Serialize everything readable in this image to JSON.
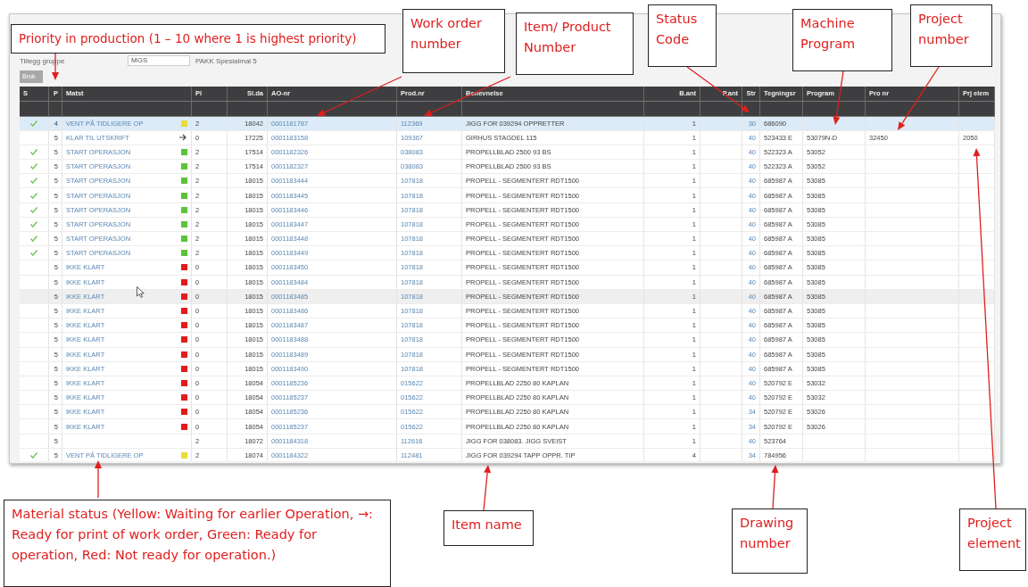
{
  "filter": {
    "label": "Tillegg gruppe",
    "value": "MGS",
    "note": "PAKK Spesialmal 5",
    "apply_button": "Bruk"
  },
  "table": {
    "columns": [
      "S",
      "P",
      "Matst",
      "Pl",
      "Sl.da",
      "AO-nr",
      "Prod.nr",
      "Benevnelse",
      "B.ant",
      "P.ant",
      "Str",
      "Tegningsr",
      "Program",
      "Pro nr",
      "Prj elem"
    ],
    "rows": [
      {
        "done": true,
        "selected": true,
        "hovered": false,
        "p": "4",
        "matst": "VENT PÅ TIDLIGERE OP",
        "material": {
          "kind": "square",
          "color": "#e8dc3a"
        },
        "pl": "2",
        "slda": "18042",
        "ao": "0001181787",
        "prod": "112369",
        "name": "JIGG FOR 039294 OPPRETTER",
        "bant": "1",
        "str": "30",
        "drawing": "686090"
      },
      {
        "done": false,
        "selected": false,
        "hovered": false,
        "p": "5",
        "matst": "KLAR TIL UTSKRIFT",
        "material": {
          "kind": "arrow"
        },
        "pl": "0",
        "slda": "17225",
        "ao": "0001183158",
        "prod": "109367",
        "name": "GIRHUS STAGDEL 115",
        "bant": "1",
        "str": "40",
        "drawing": "523433 E",
        "program": "53079N-D",
        "project": "32450",
        "element": "2050"
      },
      {
        "done": true,
        "selected": false,
        "hovered": false,
        "p": "5",
        "matst": "START OPERASJON",
        "material": {
          "kind": "square",
          "color": "#5cc23a"
        },
        "pl": "2",
        "slda": "17514",
        "ao": "0001182326",
        "prod": "038083",
        "name": "PROPELLBLAD 2500 93 BS",
        "bant": "1",
        "str": "40",
        "drawing": "522323 A",
        "program": "53052"
      },
      {
        "done": true,
        "selected": false,
        "hovered": false,
        "p": "5",
        "matst": "START OPERASJON",
        "material": {
          "kind": "square",
          "color": "#5cc23a"
        },
        "pl": "2",
        "slda": "17514",
        "ao": "0001182327",
        "prod": "038083",
        "name": "PROPELLBLAD 2500 93 BS",
        "bant": "1",
        "str": "40",
        "drawing": "522323 A",
        "program": "53052"
      },
      {
        "done": true,
        "selected": false,
        "hovered": false,
        "p": "5",
        "matst": "START OPERASJON",
        "material": {
          "kind": "square",
          "color": "#5cc23a"
        },
        "pl": "2",
        "slda": "18015",
        "ao": "0001183444",
        "prod": "107818",
        "name": "PROPELL  - SEGMENTERT RDT1500",
        "bant": "1",
        "str": "40",
        "drawing": "685987 A",
        "program": "53085"
      },
      {
        "done": true,
        "selected": false,
        "hovered": false,
        "p": "5",
        "matst": "START OPERASJON",
        "material": {
          "kind": "square",
          "color": "#5cc23a"
        },
        "pl": "2",
        "slda": "18015",
        "ao": "0001183445",
        "prod": "107818",
        "name": "PROPELL  - SEGMENTERT RDT1500",
        "bant": "1",
        "str": "40",
        "drawing": "685987 A",
        "program": "53085"
      },
      {
        "done": true,
        "selected": false,
        "hovered": false,
        "p": "5",
        "matst": "START OPERASJON",
        "material": {
          "kind": "square",
          "color": "#5cc23a"
        },
        "pl": "2",
        "slda": "18015",
        "ao": "0001183446",
        "prod": "107818",
        "name": "PROPELL  - SEGMENTERT RDT1500",
        "bant": "1",
        "str": "40",
        "drawing": "685987 A",
        "program": "53085"
      },
      {
        "done": true,
        "selected": false,
        "hovered": false,
        "p": "5",
        "matst": "START OPERASJON",
        "material": {
          "kind": "square",
          "color": "#5cc23a"
        },
        "pl": "2",
        "slda": "18015",
        "ao": "0001183447",
        "prod": "107818",
        "name": "PROPELL  - SEGMENTERT RDT1500",
        "bant": "1",
        "str": "40",
        "drawing": "685987 A",
        "program": "53085"
      },
      {
        "done": true,
        "selected": false,
        "hovered": false,
        "p": "5",
        "matst": "START OPERASJON",
        "material": {
          "kind": "square",
          "color": "#5cc23a"
        },
        "pl": "2",
        "slda": "18015",
        "ao": "0001183448",
        "prod": "107818",
        "name": "PROPELL  - SEGMENTERT RDT1500",
        "bant": "1",
        "str": "40",
        "drawing": "685987 A",
        "program": "53085"
      },
      {
        "done": true,
        "selected": false,
        "hovered": false,
        "p": "5",
        "matst": "START OPERASJON",
        "material": {
          "kind": "square",
          "color": "#5cc23a"
        },
        "pl": "2",
        "slda": "18015",
        "ao": "0001183449",
        "prod": "107818",
        "name": "PROPELL  - SEGMENTERT RDT1500",
        "bant": "1",
        "str": "40",
        "drawing": "685987 A",
        "program": "53085"
      },
      {
        "done": false,
        "selected": false,
        "hovered": false,
        "p": "5",
        "matst": "IKKE KLART",
        "material": {
          "kind": "square",
          "color": "#e21b1b"
        },
        "pl": "0",
        "slda": "18015",
        "ao": "0001183450",
        "prod": "107818",
        "name": "PROPELL  - SEGMENTERT RDT1500",
        "bant": "1",
        "str": "40",
        "drawing": "685987 A",
        "program": "53085"
      },
      {
        "done": false,
        "selected": false,
        "hovered": false,
        "p": "5",
        "matst": "IKKE KLART",
        "material": {
          "kind": "square",
          "color": "#e21b1b"
        },
        "pl": "0",
        "slda": "18015",
        "ao": "0001183484",
        "prod": "107818",
        "name": "PROPELL  - SEGMENTERT RDT1500",
        "bant": "1",
        "str": "40",
        "drawing": "685987 A",
        "program": "53085"
      },
      {
        "done": false,
        "selected": false,
        "hovered": true,
        "p": "5",
        "matst": "IKKE KLART",
        "material": {
          "kind": "square",
          "color": "#e21b1b"
        },
        "pl": "0",
        "slda": "18015",
        "ao": "0001183485",
        "prod": "107818",
        "name": "PROPELL  - SEGMENTERT RDT1500",
        "bant": "1",
        "str": "40",
        "drawing": "685987 A",
        "program": "53085"
      },
      {
        "done": false,
        "selected": false,
        "hovered": false,
        "p": "5",
        "matst": "IKKE KLART",
        "material": {
          "kind": "square",
          "color": "#e21b1b"
        },
        "pl": "0",
        "slda": "18015",
        "ao": "0001183486",
        "prod": "107818",
        "name": "PROPELL  - SEGMENTERT RDT1500",
        "bant": "1",
        "str": "40",
        "drawing": "685987 A",
        "program": "53085"
      },
      {
        "done": false,
        "selected": false,
        "hovered": false,
        "p": "5",
        "matst": "IKKE KLART",
        "material": {
          "kind": "square",
          "color": "#e21b1b"
        },
        "pl": "0",
        "slda": "18015",
        "ao": "0001183487",
        "prod": "107818",
        "name": "PROPELL  - SEGMENTERT RDT1500",
        "bant": "1",
        "str": "40",
        "drawing": "685987 A",
        "program": "53085"
      },
      {
        "done": false,
        "selected": false,
        "hovered": false,
        "p": "5",
        "matst": "IKKE KLART",
        "material": {
          "kind": "square",
          "color": "#e21b1b"
        },
        "pl": "0",
        "slda": "18015",
        "ao": "0001183488",
        "prod": "107818",
        "name": "PROPELL  - SEGMENTERT RDT1500",
        "bant": "1",
        "str": "40",
        "drawing": "685987 A",
        "program": "53085"
      },
      {
        "done": false,
        "selected": false,
        "hovered": false,
        "p": "5",
        "matst": "IKKE KLART",
        "material": {
          "kind": "square",
          "color": "#e21b1b"
        },
        "pl": "0",
        "slda": "18015",
        "ao": "0001183489",
        "prod": "107818",
        "name": "PROPELL  - SEGMENTERT RDT1500",
        "bant": "1",
        "str": "40",
        "drawing": "685987 A",
        "program": "53085"
      },
      {
        "done": false,
        "selected": false,
        "hovered": false,
        "p": "5",
        "matst": "IKKE KLART",
        "material": {
          "kind": "square",
          "color": "#e21b1b"
        },
        "pl": "0",
        "slda": "18015",
        "ao": "0001183490",
        "prod": "107818",
        "name": "PROPELL  - SEGMENTERT RDT1500",
        "bant": "1",
        "str": "40",
        "drawing": "685987 A",
        "program": "53085"
      },
      {
        "done": false,
        "selected": false,
        "hovered": false,
        "p": "5",
        "matst": "IKKE KLART",
        "material": {
          "kind": "square",
          "color": "#e21b1b"
        },
        "pl": "0",
        "slda": "18054",
        "ao": "0001185236",
        "prod": "015622",
        "name": "PROPELLBLAD 2250  80 KAPLAN",
        "bant": "1",
        "str": "40",
        "drawing": "520792 E",
        "program": "53032"
      },
      {
        "done": false,
        "selected": false,
        "hovered": false,
        "p": "5",
        "matst": "IKKE KLART",
        "material": {
          "kind": "square",
          "color": "#e21b1b"
        },
        "pl": "0",
        "slda": "18054",
        "ao": "0001185237",
        "prod": "015622",
        "name": "PROPELLBLAD 2250  80 KAPLAN",
        "bant": "1",
        "str": "40",
        "drawing": "520792 E",
        "program": "53032"
      },
      {
        "done": false,
        "selected": false,
        "hovered": false,
        "p": "5",
        "matst": "IKKE KLART",
        "material": {
          "kind": "square",
          "color": "#e21b1b"
        },
        "pl": "0",
        "slda": "18054",
        "ao": "0001185236",
        "prod": "015622",
        "name": "PROPELLBLAD 2250  80 KAPLAN",
        "bant": "1",
        "str": "34",
        "drawing": "520792 E",
        "program": "53026"
      },
      {
        "done": false,
        "selected": false,
        "hovered": false,
        "p": "5",
        "matst": "IKKE KLART",
        "material": {
          "kind": "square",
          "color": "#e21b1b"
        },
        "pl": "0",
        "slda": "18054",
        "ao": "0001185237",
        "prod": "015622",
        "name": "PROPELLBLAD 2250  80 KAPLAN",
        "bant": "1",
        "str": "34",
        "drawing": "520792 E",
        "program": "53026"
      },
      {
        "done": false,
        "selected": false,
        "hovered": false,
        "p": "5",
        "pl": "2",
        "slda": "18072",
        "ao": "0001184318",
        "prod": "112616",
        "name": "JIGG FOR 038083. JIGG SVEIST",
        "bant": "1",
        "str": "40",
        "drawing": "523764"
      },
      {
        "done": true,
        "selected": false,
        "hovered": false,
        "p": "5",
        "matst": "VENT PÅ TIDLIGERE OP",
        "material": {
          "kind": "square",
          "color": "#e8dc3a"
        },
        "pl": "2",
        "slda": "18074",
        "ao": "0001184322",
        "prod": "112481",
        "name": "JIGG FOR 039294 TAPP OPPR. TIP",
        "bant": "4",
        "str": "34",
        "drawing": "784956"
      }
    ]
  },
  "annotations": [
    {
      "text": "Priority in production (1 – 10 where 1 is highest priority)"
    },
    {
      "text": "Work order number"
    },
    {
      "text": "Item/ Product Number"
    },
    {
      "text": "Status Code"
    },
    {
      "text": "Machine Program"
    },
    {
      "text": "Project number"
    },
    {
      "text": "Material status (Yellow: Waiting for earlier Operation, →: Ready for print of work order, Green: Ready for operation, Red: Not ready for operation.)"
    },
    {
      "text": "Item name"
    },
    {
      "text": "Drawing number"
    },
    {
      "text": "Project element"
    }
  ]
}
